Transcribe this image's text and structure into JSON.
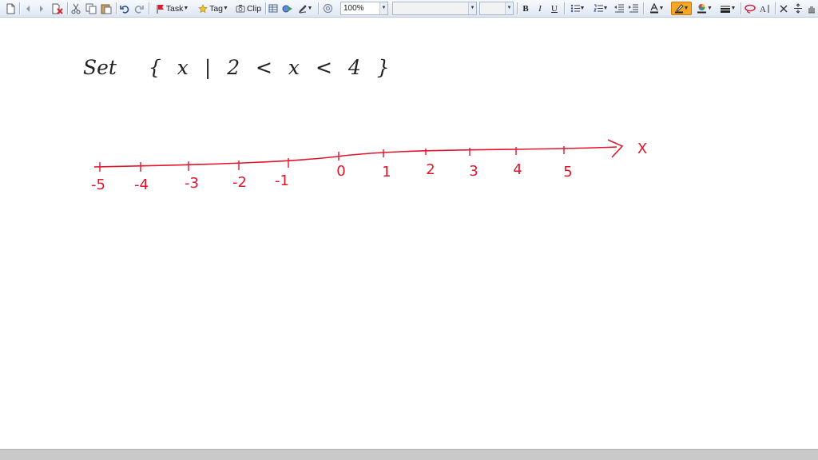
{
  "toolbar": {
    "task_label": "Task",
    "tag_label": "Tag",
    "clip_label": "Clip",
    "zoom_value": "100%",
    "font_name_value": "",
    "font_size_value": "",
    "bold_label": "B",
    "italic_label": "I",
    "underline_label": "U"
  },
  "note": {
    "set_label": "Set",
    "set_expression": "{ x | 2 < x < 4 }"
  },
  "number_line": {
    "ticks": [
      "-5",
      "-4",
      "-3",
      "-2",
      "-1",
      "0",
      "1",
      "2",
      "3",
      "4",
      "5"
    ],
    "axis_label": "X"
  },
  "colors": {
    "ink_black": "#222222",
    "ink_red": "#e4142b",
    "highlight_orange": "#f5a623",
    "toolbar_bg": "#dfe7f3"
  }
}
